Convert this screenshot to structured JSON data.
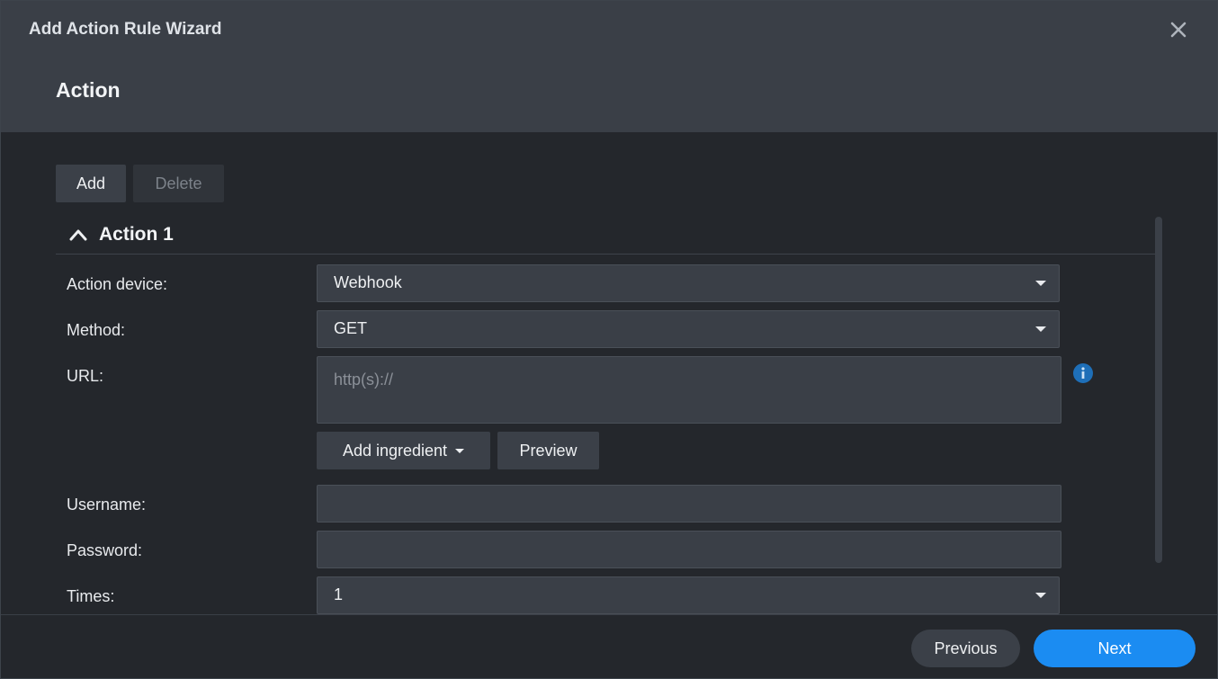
{
  "dialog": {
    "title": "Add Action Rule Wizard",
    "section_title": "Action",
    "close_icon": "close-icon"
  },
  "toolbar": {
    "add_label": "Add",
    "delete_label": "Delete"
  },
  "panel": {
    "title": "Action 1",
    "collapse_icon": "chevron-up-icon"
  },
  "form": {
    "action_device": {
      "label": "Action device:",
      "value": "Webhook"
    },
    "method": {
      "label": "Method:",
      "value": "GET"
    },
    "url": {
      "label": "URL:",
      "value": "",
      "placeholder": "http(s)://"
    },
    "add_ingredient_label": "Add ingredient",
    "preview_label": "Preview",
    "username": {
      "label": "Username:",
      "value": ""
    },
    "password": {
      "label": "Password:",
      "value": ""
    },
    "times": {
      "label": "Times:",
      "value": "1"
    }
  },
  "footer": {
    "previous_label": "Previous",
    "next_label": "Next"
  },
  "colors": {
    "accent": "#1b8cf2",
    "header_bg": "#3a3f47",
    "body_bg": "#24272c",
    "info_icon": "#1e6fb8"
  }
}
